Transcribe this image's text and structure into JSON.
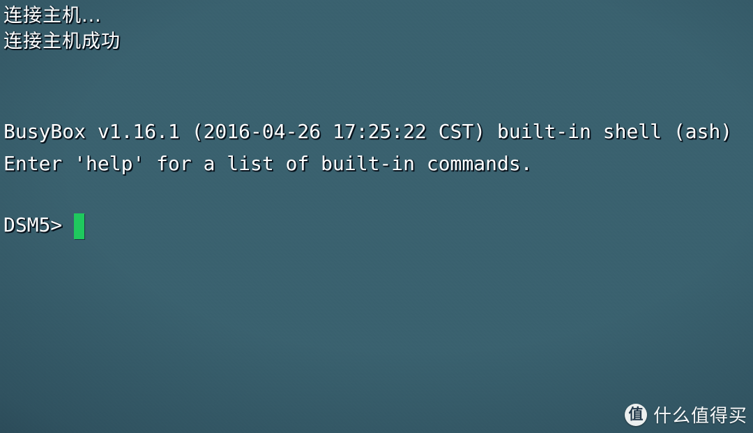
{
  "terminal": {
    "status_lines": [
      "连接主机...",
      "连接主机成功"
    ],
    "banner_line": "BusyBox v1.16.1 (2016-04-26 17:25:22 CST) built-in shell (ash)",
    "help_line": "Enter 'help' for a list of built-in commands.",
    "prompt": "DSM5>",
    "input_value": "",
    "cursor_color": "#1fc95e",
    "text_color": "#ffffff",
    "background_color": "#3a6379"
  },
  "watermark": {
    "badge_glyph": "值",
    "badge_icon": "value-badge-icon",
    "text": "什么值得买"
  }
}
